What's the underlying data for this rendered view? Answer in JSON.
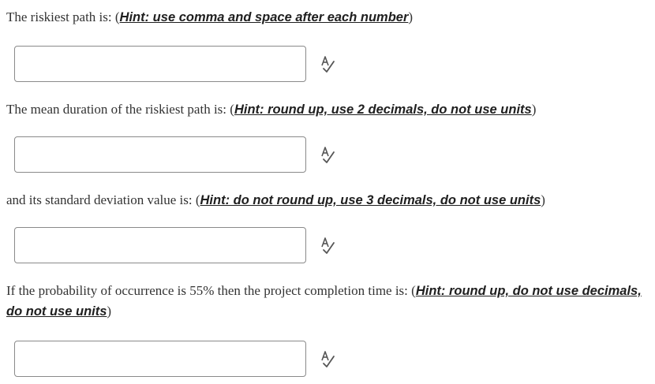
{
  "questions": [
    {
      "prefix": "The riskiest path is: (",
      "hint": "Hint: use comma and space after each number",
      "suffix": ")",
      "value": "",
      "placeholder": ""
    },
    {
      "prefix": "The mean duration of the riskiest path is: (",
      "hint": "Hint: round up, use 2 decimals, do not use units",
      "suffix": ")",
      "value": "",
      "placeholder": ""
    },
    {
      "prefix": "and its standard deviation value is: (",
      "hint": "Hint: do not round up, use 3 decimals, do not use units",
      "suffix": ")",
      "value": "",
      "placeholder": ""
    },
    {
      "prefix": "If the probability of occurrence is 55% then the project completion time is: (",
      "hint": "Hint: round up, do not use decimals, do not use units",
      "suffix": ")",
      "value": "",
      "placeholder": ""
    }
  ],
  "icons": {
    "spellcheck": "spellcheck-icon"
  },
  "colors": {
    "text": "#333333",
    "hint": "#1f1f1f",
    "input_border": "#8a8a8a",
    "icon": "#555555"
  }
}
